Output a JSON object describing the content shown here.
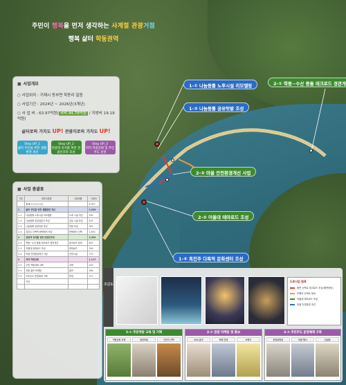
{
  "title": {
    "line1_parts": [
      "주민이 ",
      "행복",
      "을 먼저 생각하는 ",
      "사계절 관광",
      "거점"
    ],
    "line2_parts": [
      "행복 삶터 ",
      "학동권역"
    ]
  },
  "overview": {
    "heading": "사업개요",
    "items": [
      {
        "label": "사업위치 :",
        "value": "거제시 동부면 학동리 일원"
      },
      {
        "label": "사업기간 :",
        "value": "2024년 ~ 2026년(3개년)"
      },
      {
        "label": "사 업 비 :",
        "value": "63.97억원",
        "highlight": "국비 44.78억원",
        "suffix": " / 지방비 19.19억원"
      }
    ],
    "slogan": {
      "part1": "삶터로의 가치도 ",
      "up1": "UP!",
      "part2": " 관광지로의 가치도 ",
      "up2": "UP!"
    },
    "steps": [
      {
        "title": "Step UP_1",
        "text": "삶터 주민을 위한 생활환경 개선",
        "color": "#3aa6c9"
      },
      {
        "title": "Step UP_2",
        "text": "관광객 유치를 위한 관광인프라 조성",
        "color": "#3d8a2e"
      },
      {
        "title": "Step UP_3",
        "text": "지역 역량강화 및 주민 주도 운영",
        "color": "#9b5aa8"
      }
    ]
  },
  "table": {
    "heading": "사업 총괄표",
    "headers": [
      "구분",
      "세부사업명",
      "사업내용",
      "사업비"
    ],
    "rows": [
      {
        "cls": "",
        "cells": [
          "",
          "합계(1)+(2)+(3)",
          "",
          "6,397"
        ]
      },
      {
        "cls": "sec",
        "cells": [
          "1",
          "삶터 주민을 위한 생활환경 개선",
          "",
          "2,930"
        ]
      },
      {
        "cls": "",
        "cells": [
          "1-①",
          "나눔동률 노후시설 리모델링",
          "노후 시설 개선",
          "550"
        ]
      },
      {
        "cls": "",
        "cells": [
          "1-②",
          "나눔동률 공유냉장고 조성",
          "공유 시설 조성",
          "430"
        ]
      },
      {
        "cls": "",
        "cells": [
          "1-③",
          "나눔동률 공유텃밭 조성",
          "텃밭 조성",
          "320"
        ]
      },
      {
        "cls": "",
        "cells": [
          "1-④",
          "흑진주 다목적 문화센터 조성",
          "문화센터 신축",
          "1,630"
        ]
      },
      {
        "cls": "sec2",
        "cells": [
          "2",
          "관광객 유치를 위한 관광인프라",
          "",
          "2,350"
        ]
      },
      {
        "cls": "",
        "cells": [
          "2-①",
          "학동~수산 몽돌 데크로드 경관개선",
          "데크로드 정비",
          "820"
        ]
      },
      {
        "cls": "",
        "cells": [
          "2-②",
          "어울대 테마로드 조성",
          "테마로드",
          "760"
        ]
      },
      {
        "cls": "",
        "cells": [
          "2-③",
          "마을 안전환경개선 사업",
          "안전시설",
          "770"
        ]
      },
      {
        "cls": "sec3",
        "cells": [
          "3",
          "지역 역량강화",
          "",
          "1,117"
        ]
      },
      {
        "cls": "",
        "cells": [
          "3-①",
          "주민 역량강화 교육",
          "교육",
          "420"
        ]
      },
      {
        "cls": "",
        "cells": [
          "3-②",
          "관광 홍보 마케팅",
          "홍보",
          "380"
        ]
      },
      {
        "cls": "",
        "cells": [
          "3-③",
          "주민주도 운영체계 구축",
          "운영",
          "317"
        ]
      },
      {
        "cls": "",
        "cells": [
          "",
          "기타",
          "",
          ""
        ]
      },
      {
        "cls": "",
        "cells": [
          "",
          "",
          "",
          ""
        ]
      }
    ]
  },
  "callouts": [
    {
      "id": "c1",
      "text": "1-① 나눔동률 노후시설 리모델링",
      "color": "blue"
    },
    {
      "id": "c2",
      "text": "1-③ 나눔동률 공유텃밭 조성",
      "color": "blue"
    },
    {
      "id": "c3",
      "text": "2-① 학동~수산 몽돌 데크로드 경관개선",
      "color": "green"
    },
    {
      "id": "c4",
      "text": "2-③ 마을 안전환경개선 사업",
      "color": "green"
    },
    {
      "id": "c5",
      "text": "2-② 어울대 테마로드 조성",
      "color": "green"
    },
    {
      "id": "c6",
      "text": "1-④ 흑진주 다목적 문화센터 조성",
      "color": "blue"
    }
  ],
  "plan": {
    "side_label": "조감도",
    "legend_title": "도로사업 범례",
    "legend": [
      {
        "text": "해변 산책로 데크로드 조성(해변정비)",
        "color": "#e8392b"
      },
      {
        "text": "보행자 산책로 정비",
        "color": "#f29a2e"
      },
      {
        "text": "어울대 테마로드 조성",
        "color": "#3d8a2e"
      },
      {
        "text": "마을 안전환경 개선",
        "color": "#2a6bc4"
      }
    ],
    "groups": [
      {
        "title": "3-① 주민역량 교육 및 기획",
        "color": "#3d8a2e",
        "tags": [
          "역량강화 교육",
          "현장포럼",
          "선진지 견학"
        ]
      },
      {
        "title": "3-② 관광 마케팅 및 홍보",
        "color": "#9b5aa8",
        "tags": [
          "SNS 홍보",
          "축제 연계",
          "브랜드"
        ]
      },
      {
        "title": "3-③ 주민주도 운영체계 구축",
        "color": "#9b5aa8",
        "tags": [
          "운영위원회",
          "마을 행사",
          "컨설팅"
        ]
      }
    ]
  }
}
